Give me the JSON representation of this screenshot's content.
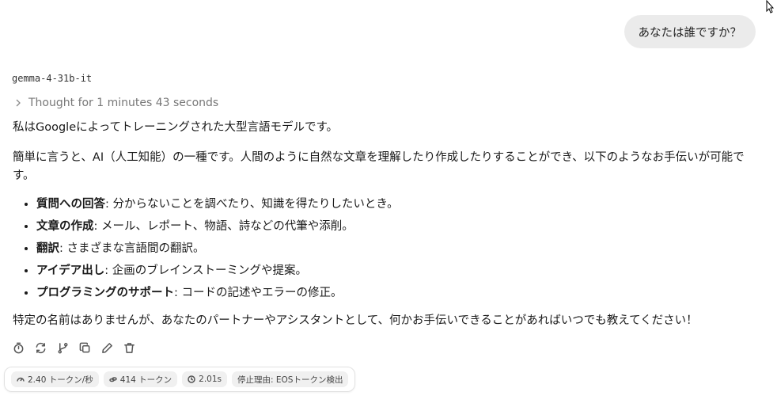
{
  "user_message": "あなたは誰ですか？",
  "model_name": "gemma-4-31b-it",
  "thought_label": "Thought for 1 minutes 43 seconds",
  "response": {
    "p1": "私はGoogleによってトレーニングされた大型言語モデルです。",
    "p2": "簡単に言うと、AI（人工知能）の一種です。人間のように自然な文章を理解したり作成したりすることができ、以下のようなお手伝いが可能です。",
    "items": [
      {
        "title": "質問への回答",
        "desc": ": 分からないことを調べたり、知識を得たりしたいとき。"
      },
      {
        "title": "文章の作成",
        "desc": ": メール、レポート、物語、詩などの代筆や添削。"
      },
      {
        "title": "翻訳",
        "desc": ": さまざまな言語間の翻訳。"
      },
      {
        "title": "アイデア出し",
        "desc": ": 企画のブレインストーミングや提案。"
      },
      {
        "title": "プログラミングのサポート",
        "desc": ": コードの記述やエラーの修正。"
      }
    ],
    "p3": "特定の名前はありませんが、あなたのパートナーやアシスタントとして、何かお手伝いできることがあればいつでも教えてください！"
  },
  "actions": [
    "timer-icon",
    "regenerate-icon",
    "branch-icon",
    "copy-icon",
    "edit-icon",
    "delete-icon"
  ],
  "stats": {
    "speed": "2.40 トークン/秒",
    "tokens": "414 トークン",
    "time": "2.01s",
    "stop_reason": "停止理由: EOSトークン検出"
  }
}
